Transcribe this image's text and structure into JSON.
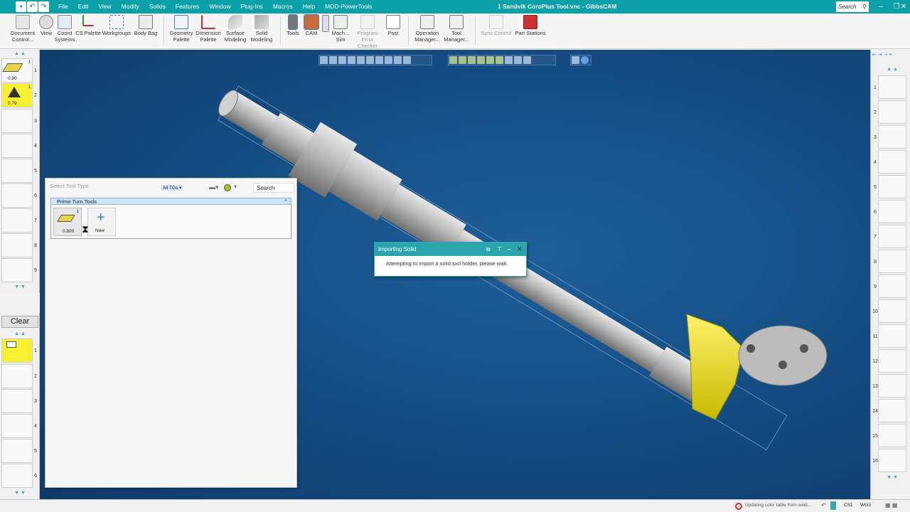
{
  "window": {
    "title": "1 Sandvik CoroPlus Tool.vnc - GibbsCAM",
    "search_placeholder": "Search",
    "menu": [
      "File",
      "Edit",
      "View",
      "Modify",
      "Solids",
      "Features",
      "Window",
      "Plug-Ins",
      "Macros",
      "Help",
      "MDD-PowerTools"
    ]
  },
  "ribbon": {
    "document_control": "Document Control...",
    "view": "View",
    "coord_systems": "Coord Systems",
    "cs_palette": "CS Palette",
    "workgroups": "Workgroups",
    "body_bag": "Body Bag",
    "geometry_palette": "Geometry Palette",
    "dimension_palette": "Dimension Palette",
    "surface_modeling": "Surface Modeling",
    "solid_modeling": "Solid Modeling",
    "tools": "Tools",
    "cam": "CAM",
    "mach_sim": "Mach... Sim",
    "program_error_checker": "Program Error Checker",
    "post": "Post",
    "operation_manager": "Operation Manager...",
    "tool_manager": "Tool Manager...",
    "sync_control": "Sync Control",
    "part_stations": "Part Stations"
  },
  "tool_list": {
    "tools": [
      {
        "num": "1",
        "value": "0.80",
        "badge": "1"
      },
      {
        "num": "2",
        "value": "0.79",
        "badge": "1"
      }
    ],
    "slot_numbers": [
      "3",
      "4",
      "5",
      "6",
      "7",
      "8",
      "9"
    ]
  },
  "process_list": {
    "clear_label": "Clear",
    "slot_numbers": [
      "1",
      "2",
      "3",
      "4",
      "5",
      "6"
    ]
  },
  "tool_palette": {
    "header": "Select Tool Type",
    "filter": "All TGs",
    "search_label": "Search",
    "group_title": "Prime Turn Tools",
    "tool_value": "0.800",
    "tool_badge": "1",
    "new_label": "New"
  },
  "dialog": {
    "title": "Importing Solid",
    "message": "Attempting to import a solid tool holder, please wait."
  },
  "right_strip": {
    "numbers": [
      "1",
      "2",
      "3",
      "4",
      "5",
      "6",
      "7",
      "8",
      "9",
      "10",
      "11",
      "12",
      "13",
      "14",
      "15",
      "16"
    ]
  },
  "status": {
    "message": "Updating color table from solid...",
    "cs": "CS1",
    "wg": "WG3"
  },
  "colors": {
    "titlebar": "#0aa0a8",
    "viewport": "#154f86",
    "highlight": "#f7f030"
  }
}
